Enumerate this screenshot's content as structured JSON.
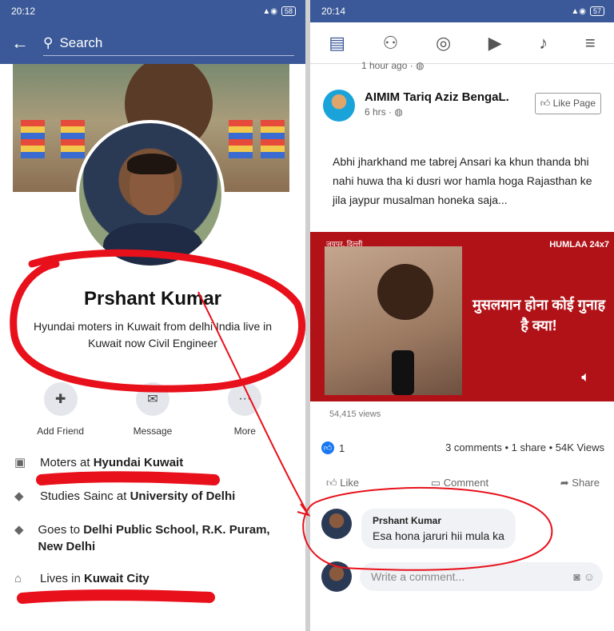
{
  "left": {
    "status": {
      "time": "20:12",
      "battery": "58"
    },
    "search_placeholder": "Search",
    "profile_name": "Prshant Kumar",
    "bio": "Hyundai  moters in Kuwait  from delhi India live  in  Kuwait now Civil Engineer",
    "actions": [
      {
        "label": "Add Friend",
        "icon": "add-friend-icon"
      },
      {
        "label": "Message",
        "icon": "message-icon"
      },
      {
        "label": "More",
        "icon": "more-icon"
      }
    ],
    "info": [
      {
        "prefix": "Moters at ",
        "bold": "Hyundai Kuwait",
        "suffix": "",
        "icon": "briefcase-icon"
      },
      {
        "prefix": "Studies Sainc at ",
        "bold": "University of Delhi",
        "suffix": "",
        "icon": "graduation-cap-icon"
      },
      {
        "prefix": "Goes to ",
        "bold": "Delhi Public School, R.K. Puram, New Delhi",
        "suffix": "",
        "icon": "graduation-cap-icon"
      },
      {
        "prefix": "Lives in ",
        "bold": "Kuwait City",
        "suffix": "",
        "icon": "home-icon"
      }
    ]
  },
  "right": {
    "status": {
      "time": "20:14",
      "battery": "57"
    },
    "nav_icons": [
      "news-feed-icon",
      "friends-icon",
      "groups-icon",
      "watch-icon",
      "notifications-icon",
      "menu-icon"
    ],
    "prev_time": "1 hour ago · ",
    "post": {
      "author": "AIMIM Tariq Aziz BengaL.",
      "time": "6 hrs · ",
      "like_page": "Like Page",
      "text": "Abhi jharkhand me tabrej Ansari ka khun thanda bhi nahi huwa tha ki dusri wor hamla hoga Rajasthan ke jila jaypur musalman honeka saja...",
      "video_caption": "मुसलमान होना कोई गुनाह है क्या!",
      "video_logo": "HUMLAA 24x7",
      "video_location": "जयपुर, दिल्ली",
      "views": "54,415 views",
      "reactions": "1",
      "stats": "3 comments • 1 share • 54K Views",
      "like": "Like",
      "comment": "Comment",
      "share": "Share"
    },
    "comment": {
      "author": "Prshant Kumar",
      "text": "Esa hona jaruri hii mula ka"
    },
    "write_placeholder": "Write a comment..."
  },
  "annotation_color": "#e8101b"
}
